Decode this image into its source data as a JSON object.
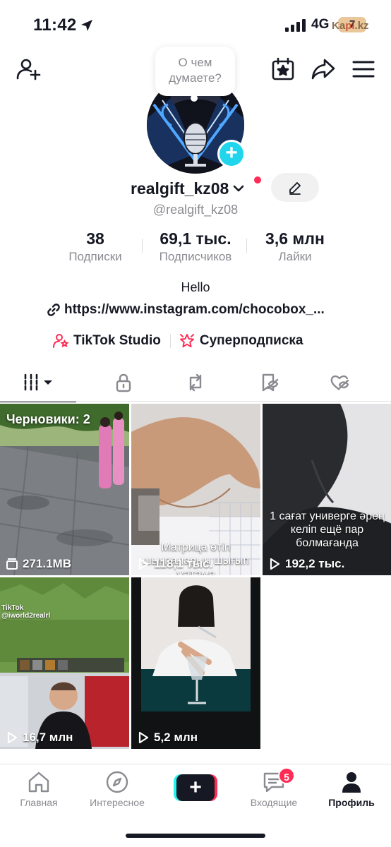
{
  "status_bar": {
    "time": "11:42",
    "network": "4G",
    "battery": "7",
    "watermark_prefix": "Ka",
    "watermark_accent": "pi",
    "watermark_suffix": ".kz"
  },
  "header": {
    "icons": [
      "add-friend-icon",
      "calendar-star-icon",
      "share-arrow-icon",
      "hamburger-menu-icon"
    ]
  },
  "profile": {
    "thought_prompt": "О чем думаете?",
    "username": "realgift_kz08",
    "handle": "@realgift_kz08",
    "bio": "Hello",
    "link": "https://www.instagram.com/chocobox_...",
    "colors": {
      "accent_cyan": "#20d5ec",
      "accent_red": "#fe2c55",
      "muted": "#8a8b91"
    }
  },
  "stats": {
    "following_value": "38",
    "following_label": "Подписки",
    "followers_value": "69,1 тыс.",
    "followers_label": "Подписчиков",
    "likes_value": "3,6 млн",
    "likes_label": "Лайки"
  },
  "chips": {
    "studio": "TikTok Studio",
    "subscription": "Суперподписка"
  },
  "tabs": [
    {
      "name": "videos",
      "icon": "grid-bars-icon",
      "active": true
    },
    {
      "name": "private",
      "icon": "lock-icon",
      "active": false
    },
    {
      "name": "reposts",
      "icon": "repost-icon",
      "active": false
    },
    {
      "name": "favorites",
      "icon": "bookmark-hidden-icon",
      "active": false
    },
    {
      "name": "liked",
      "icon": "heart-hidden-icon",
      "active": false
    }
  ],
  "videos": [
    {
      "drafts_label": "Черновики: 2",
      "count": "271.1MB",
      "count_icon": "drafts-folder-icon"
    },
    {
      "caption_line1": "Матрица өтіп",
      "caption_line2": "шықпаларын шығып",
      "caption_line3": "жатама",
      "count": "118,1 тыс.",
      "count_icon": "play-icon"
    },
    {
      "caption_line1": "1 сағат универге әрең",
      "caption_line2": "келіп ещё пар",
      "caption_line3": "болмағанда",
      "count": "192,2 тыс.",
      "count_icon": "play-icon"
    },
    {
      "overlay_brand": "TikTok",
      "overlay_user": "@iworld2realrl",
      "count": "16,7 млн",
      "count_icon": "play-icon"
    },
    {
      "count": "5,2 млн",
      "count_icon": "play-icon"
    }
  ],
  "bottom_nav": {
    "home": "Главная",
    "discover": "Интересное",
    "inbox": "Входящие",
    "inbox_badge": "5",
    "profile": "Профиль",
    "create_symbol": "+"
  }
}
